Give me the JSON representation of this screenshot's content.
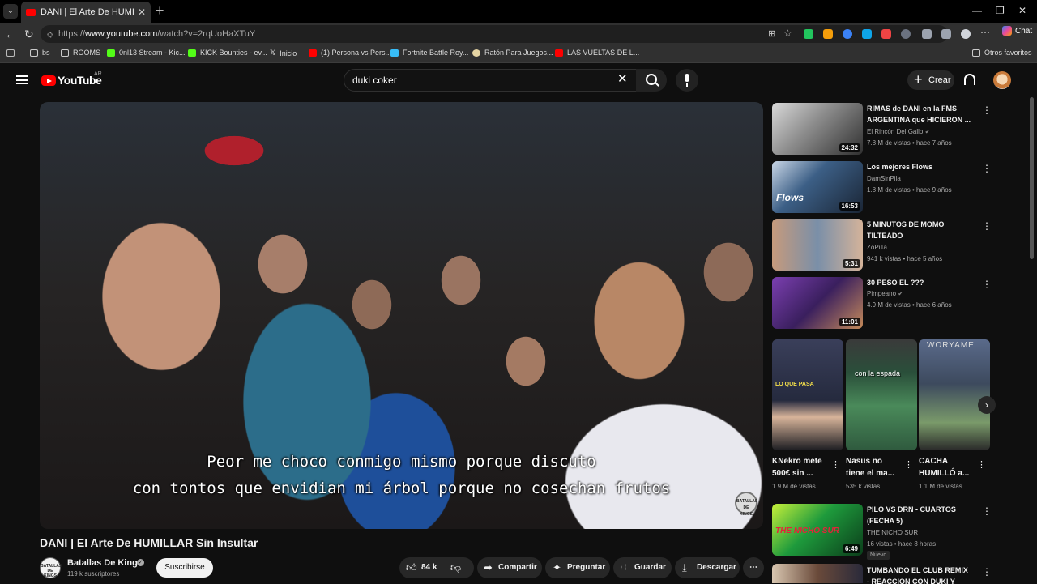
{
  "browser": {
    "tab_title": "DANI | El Arte De HUMILLAR Sin Insultar",
    "url_prefix": "https://",
    "url_domain": "www.youtube.com",
    "url_path": "/watch?v=2rqUoHaXTuY",
    "chat_label": "Chat",
    "bookmarks": [
      {
        "label": "bs"
      },
      {
        "label": "ROOMS"
      },
      {
        "label": "0nl13 Stream - Kic..."
      },
      {
        "label": "KICK Bounties - ev..."
      },
      {
        "label": "Inicio"
      },
      {
        "label": "(1) Persona vs Pers..."
      },
      {
        "label": "Fortnite Battle Roy..."
      },
      {
        "label": "Ratón Para Juegos..."
      },
      {
        "label": "LAS VUELTAS DE L..."
      }
    ],
    "other_favorites": "Otros favoritos"
  },
  "youtube": {
    "logo_text": "YouTube",
    "region": "AR",
    "search_value": "duki coker",
    "create_label": "Crear"
  },
  "video": {
    "subtitle_line1": "Peor me choco conmigo mismo porque discuto",
    "subtitle_line2": "con tontos que envidian mi árbol porque no cosechan frutos",
    "watermark": "BATALLAS DE KINGS",
    "title": "DANI | El Arte De HUMILLAR Sin Insultar",
    "channel": "Batallas De Kings",
    "channel_avatar": "BATALLAS DE KINGS",
    "subscribers": "119 k suscriptores",
    "subscribe_label": "Suscribirse",
    "likes": "84 k",
    "share_label": "Compartir",
    "ask_label": "Preguntar",
    "save_label": "Guardar",
    "download_label": "Descargar"
  },
  "sidebar": {
    "videos": [
      {
        "title": "RIMAS de DANI en la FMS ARGENTINA que  HICIERON ...",
        "channel": "El Rincón Del Gallo",
        "meta": "7.8 M de vistas • hace 7 años",
        "duration": "24:32"
      },
      {
        "title": "Los mejores Flows",
        "channel": "DamSinPila",
        "meta": "1.8 M de vistas • hace 9 años",
        "duration": "16:53"
      },
      {
        "title": "5 MINUTOS DE MOMO TILTEADO",
        "channel": "ZoPiTa",
        "meta": "941 k vistas • hace 5 años",
        "duration": "5:31"
      },
      {
        "title": "30 PESO EL ???",
        "channel": "Pimpeano",
        "meta": "4.9 M de vistas • hace 6 años",
        "duration": "11:01"
      },
      {
        "title": "PILO VS DRN - CUARTOS (FECHA 5)",
        "channel": "THE NICHO SUR",
        "meta": "16 vistas • hace 8 horas",
        "duration": "6:49",
        "badge": "Nuevo"
      },
      {
        "title": "TUMBANDO EL CLUB REMIX - REACCION CON DUKI Y ZORA"
      }
    ],
    "shorts": [
      {
        "title": "KNekro mete 500€ sin ...",
        "views": "1.9 M de vistas",
        "overlay": "LO QUE PASA"
      },
      {
        "title": "Nasus no tiene el ma...",
        "views": "535 k vistas",
        "overlay": "con la espada"
      },
      {
        "title": "CACHA HUMILLÓ a...",
        "views": "1.1 M de vistas",
        "overlay": "WORYAME"
      }
    ]
  }
}
